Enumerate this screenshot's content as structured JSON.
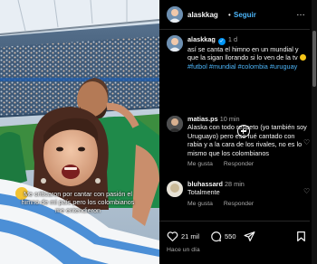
{
  "header": {
    "username": "alaskkag",
    "separator": "•",
    "follow_label": "Seguir",
    "more_icon": "…"
  },
  "post": {
    "username": "alaskkag",
    "time": "1 d",
    "caption": "así se canta el himno en un mundial y que la sigan llorando si lo ven de la tv",
    "hashtags": "#futbol #mundial #colombia #uruguay"
  },
  "media": {
    "overlay_caption": "Me criticaron por cantar con pasión el himno de mi país pero los colombianos me entendieron"
  },
  "comments": [
    {
      "username": "matias.ps",
      "time": "10 min",
      "text": "Alaska con todo respeto (yo también soy Uruguayo) pero eso fué cantado con rabia y a la cara de los rivales, no es lo mismo que los colombianos",
      "like_label": "Me gusta",
      "reply_label": "Responder"
    },
    {
      "username": "bluhassard",
      "time": "28 min",
      "text": "Totalmente",
      "like_label": "Me gusta",
      "reply_label": "Responder"
    }
  ],
  "footer": {
    "likes": "21 mil",
    "comments": "550",
    "posted": "Hace un día"
  },
  "colors": {
    "background": "#000000",
    "text": "#f5f5f5",
    "link": "#4cb5f9",
    "muted": "#a8a8a8",
    "verified": "#0095f6"
  }
}
